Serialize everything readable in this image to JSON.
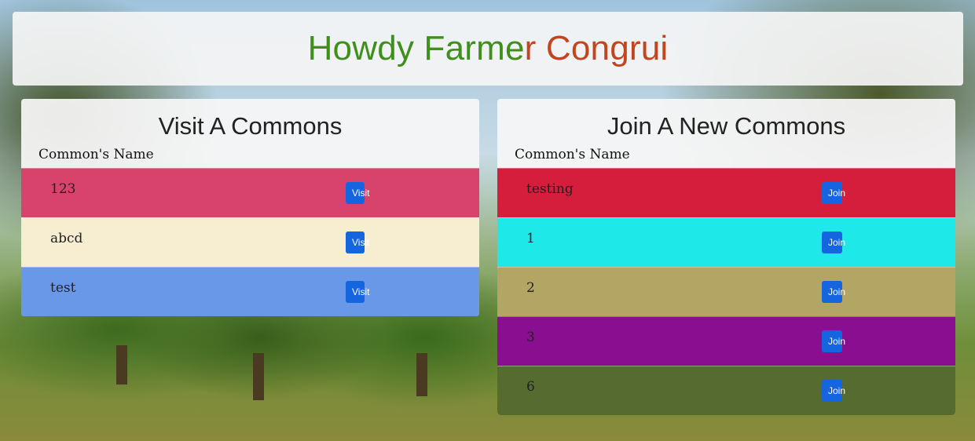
{
  "header": {
    "greeting": "Howdy Farme",
    "greeting_last_letter": "r",
    "name": " Congrui",
    "greeting_color": "#3f8f1d",
    "name_color": "#c2451f"
  },
  "visit_card": {
    "title": "Visit A Commons",
    "column_header": "Common's Name",
    "button_label": "Visit",
    "rows": [
      {
        "name": "123",
        "color": "#d8436b"
      },
      {
        "name": "abcd",
        "color": "#f7edd0"
      },
      {
        "name": "test",
        "color": "#6a98e8"
      }
    ]
  },
  "join_card": {
    "title": "Join A New Commons",
    "column_header": "Common's Name",
    "button_label": "Join",
    "rows": [
      {
        "name": "testing",
        "color": "#d41e3c"
      },
      {
        "name": "1",
        "color": "#1ee8e8"
      },
      {
        "name": "2",
        "color": "#b3a665"
      },
      {
        "name": "3",
        "color": "#8a0f90"
      },
      {
        "name": "6",
        "color": "#556b2f"
      }
    ]
  }
}
